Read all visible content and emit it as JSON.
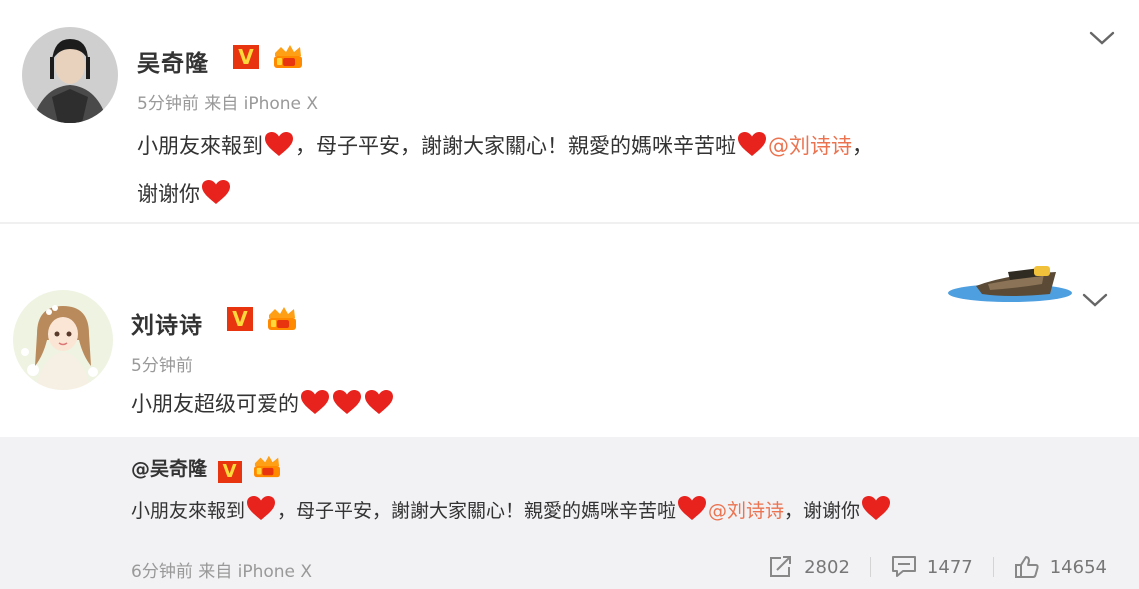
{
  "post1": {
    "author": "吴奇隆",
    "badge": "V",
    "time": "5分钟前",
    "source": "来自 iPhone X",
    "line1_a": "小朋友來報到",
    "line1_b": "，母子平安，謝謝大家關心！親愛的媽咪辛苦啦",
    "mention": "@刘诗诗",
    "line1_c": "，",
    "line2": "谢谢你"
  },
  "post2": {
    "author": "刘诗诗",
    "badge": "V",
    "time": "5分钟前",
    "content": "小朋友超级可爱的",
    "repost": {
      "author": "@吴奇隆",
      "badge": "V",
      "text_a": "小朋友來報到",
      "text_b": "，母子平安，謝謝大家關心！親愛的媽咪辛苦啦",
      "mention": "@刘诗诗",
      "text_c": "，谢谢你",
      "time": "6分钟前",
      "source": "来自 iPhone X"
    },
    "stats": {
      "reposts": "2802",
      "comments": "1477",
      "likes": "14654"
    }
  },
  "icons": {
    "verified": "verified-v-badge",
    "member": "member-crown-icon",
    "heart": "red-heart-emoji",
    "dropdown": "chevron-down-icon",
    "repost": "repost-icon",
    "comment": "comment-icon",
    "like": "thumbs-up-icon"
  },
  "colors": {
    "mention": "#eb7350",
    "badge_bg": "#e8340f",
    "badge_text": "#ffd83b",
    "heart": "#e8221c",
    "repost_bg": "#f2f2f5"
  }
}
